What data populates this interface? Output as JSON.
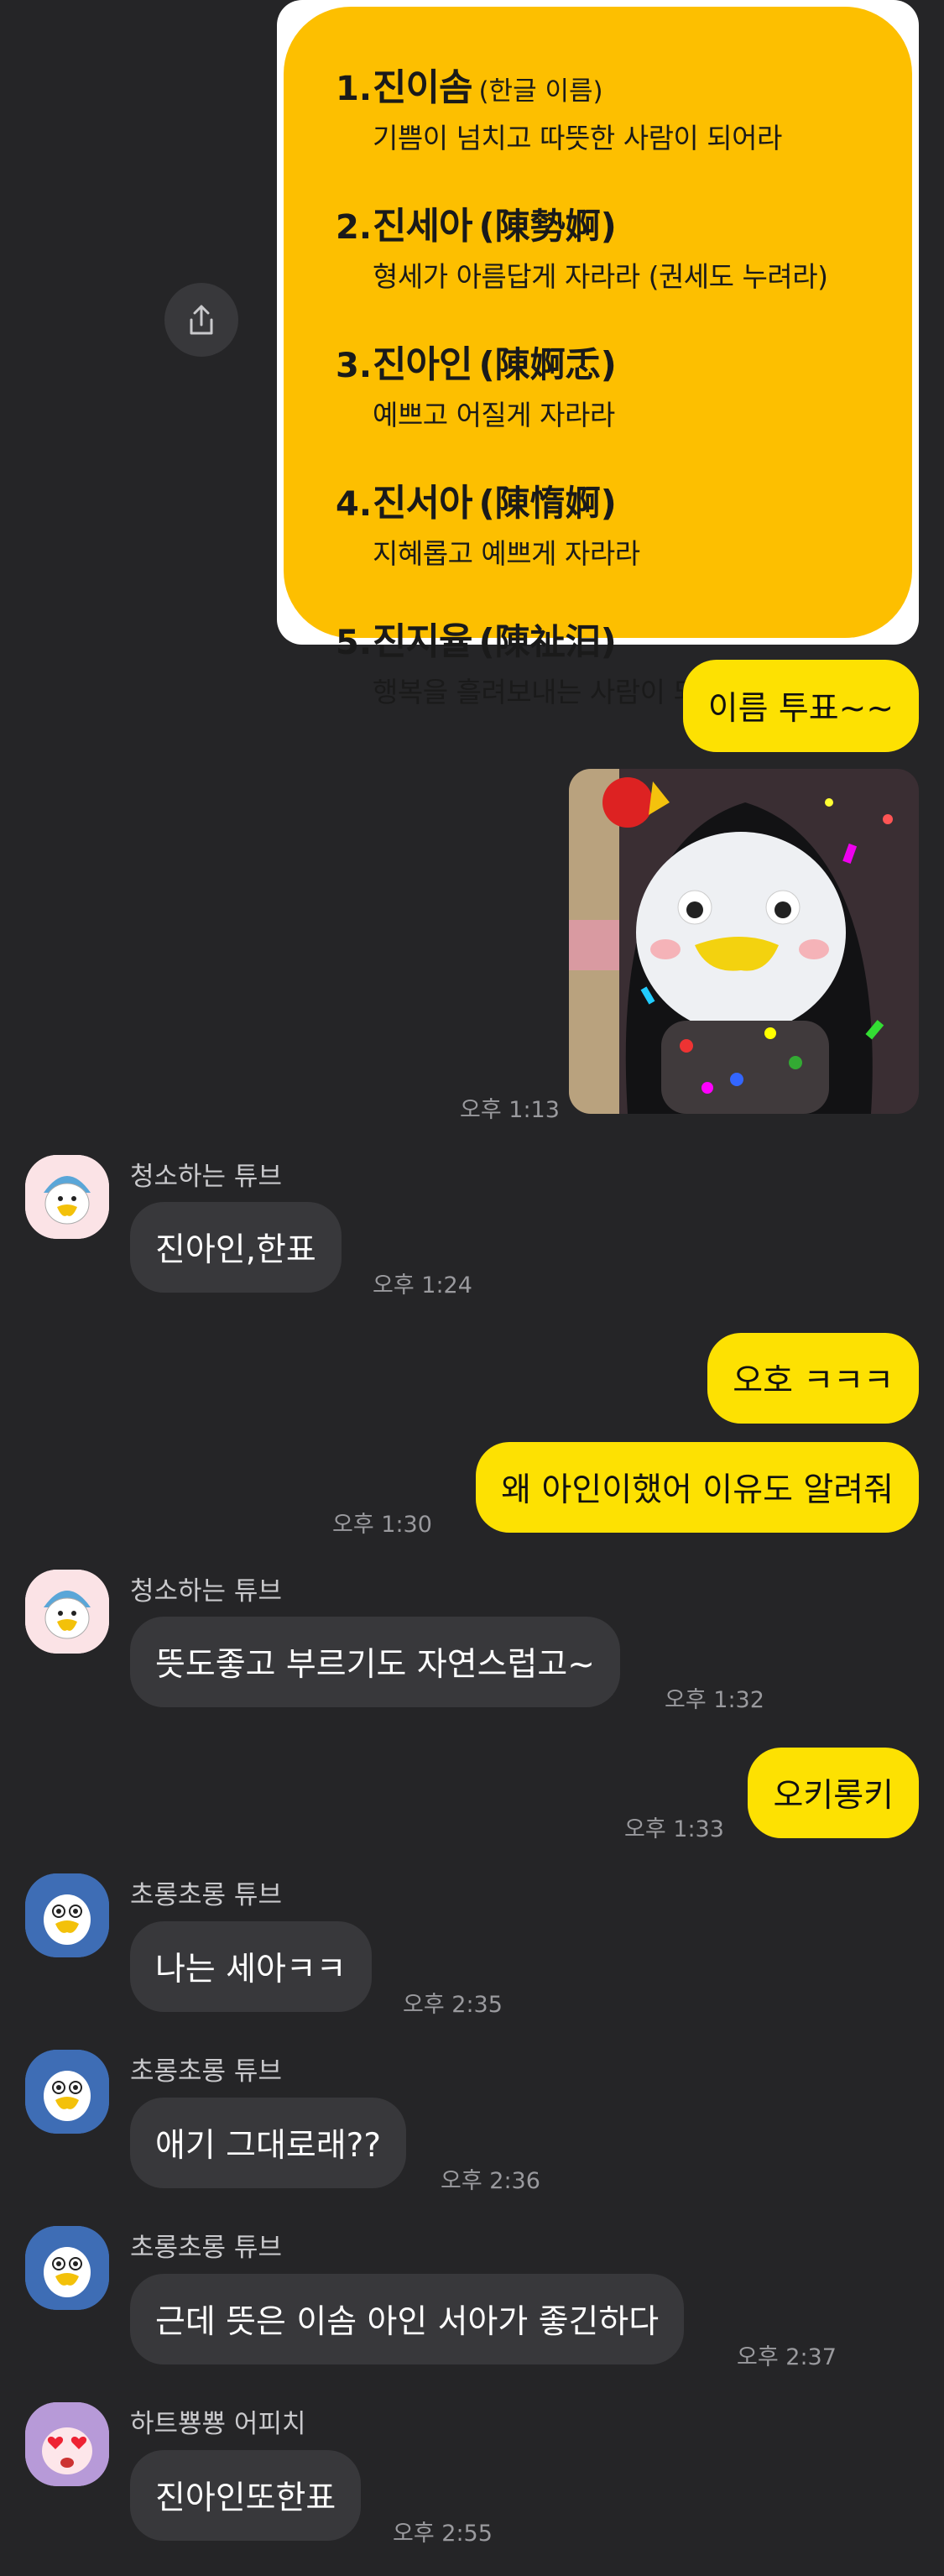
{
  "names_card": {
    "items": [
      {
        "num": "1.",
        "name": "진이솜",
        "hanja": "",
        "small": "(한글 이름)",
        "meaning": "기쁨이 넘치고 따뜻한 사람이 되어라"
      },
      {
        "num": "2.",
        "name": "진세아",
        "hanja": "(陳勢婀)",
        "small": "",
        "meaning": "형세가 아름답게 자라라 (권세도 누려라)"
      },
      {
        "num": "3.",
        "name": "진아인",
        "hanja": "(陳婀忎)",
        "small": "",
        "meaning": "예쁘고 어질게 자라라"
      },
      {
        "num": "4.",
        "name": "진서아",
        "hanja": "(陳惰婀)",
        "small": "",
        "meaning": "지혜롭고 예쁘게 자라라"
      },
      {
        "num": "5.",
        "name": "진지율",
        "hanja": "(陳祉汨)",
        "small": "",
        "meaning": "행복을 흘려보내는 사람이 되어라"
      }
    ]
  },
  "messages": {
    "m1": {
      "text": "이름 투표~~"
    },
    "m1_time": "오후 1:13",
    "m2_sender": "청소하는 튜브",
    "m2": {
      "text": "진아인,한표",
      "time": "오후 1:24"
    },
    "m3": {
      "text": "오호 ㅋㅋㅋ"
    },
    "m4": {
      "text": "왜 아인이했어 이유도 알려줘",
      "time": "오후 1:30"
    },
    "m5_sender": "청소하는 튜브",
    "m5": {
      "text": "뜻도좋고 부르기도 자연스럽고~",
      "time": "오후 1:32"
    },
    "m6": {
      "text": "오키롱키",
      "time": "오후 1:33"
    },
    "m7_sender": "초롱초롱 튜브",
    "m7": {
      "text": "나는 세아ㅋㅋ",
      "time": "오후 2:35"
    },
    "m8_sender": "초롱초롱 튜브",
    "m8": {
      "text": "애기 그대로래??",
      "time": "오후 2:36"
    },
    "m9_sender": "초롱초롱 튜브",
    "m9": {
      "text": "근데 뜻은 이솜 아인 서아가 좋긴하다",
      "time": "오후 2:37"
    },
    "m10_sender": "하트뿅뿅 어피치",
    "m10": {
      "text": "진아인또한표",
      "time": "오후 2:55"
    }
  },
  "colors": {
    "background": "#252527",
    "my_bubble": "#fde102",
    "other_bubble": "#38383b",
    "card_yellow": "#fdbf00"
  },
  "icons": [
    "share-icon",
    "tube-cleaning-avatar",
    "tube-sparkle-avatar",
    "apeach-heart-avatar",
    "sticker-penguin"
  ]
}
